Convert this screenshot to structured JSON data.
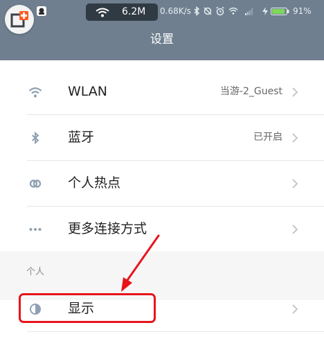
{
  "status_bar": {
    "network_speed_pill": "6.2M",
    "net_speed": "0.68K/s",
    "battery_percent": "91%",
    "battery_level": 0.91,
    "battery_color": "#7fd85a"
  },
  "header": {
    "title": "设置",
    "bg_color": "#6f7f8f"
  },
  "rows": [
    {
      "icon": "wifi-icon",
      "label": "WLAN",
      "value": "当游-2_Guest"
    },
    {
      "icon": "bluetooth-icon",
      "label": "蓝牙",
      "value": "已开启"
    },
    {
      "icon": "hotspot-icon",
      "label": "个人热点",
      "value": ""
    },
    {
      "icon": "more-dots-icon",
      "label": "更多连接方式",
      "value": ""
    }
  ],
  "section": {
    "label": "个人"
  },
  "display_row": {
    "icon": "display-contrast-icon",
    "label": "显示"
  },
  "annotation": {
    "color": "#e8141a"
  }
}
